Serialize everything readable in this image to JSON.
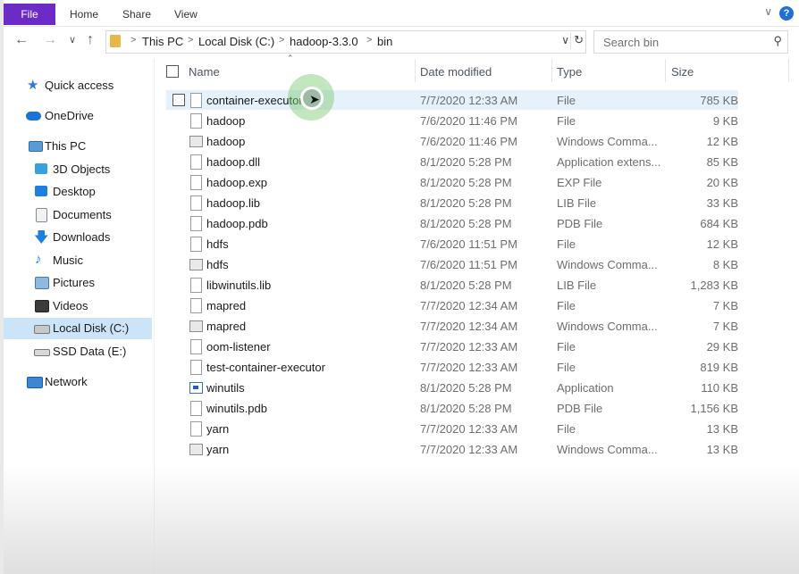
{
  "ribbon": {
    "tabs": [
      "File",
      "Home",
      "Share",
      "View"
    ],
    "help_icon": "help-icon",
    "accent": "#6c2bc6"
  },
  "address": {
    "crumbs": [
      "This PC",
      "Local Disk (C:)",
      "hadoop-3.3.0",
      "bin"
    ]
  },
  "search": {
    "placeholder": "Search bin"
  },
  "sidebar": {
    "items": [
      {
        "label": "Quick access",
        "icon": "star-icon"
      },
      {
        "label": "OneDrive",
        "icon": "cloud-icon"
      },
      {
        "label": "This PC",
        "icon": "computer-icon"
      },
      {
        "label": "3D Objects",
        "icon": "cube-icon"
      },
      {
        "label": "Desktop",
        "icon": "desktop-icon"
      },
      {
        "label": "Documents",
        "icon": "documents-icon"
      },
      {
        "label": "Downloads",
        "icon": "download-icon"
      },
      {
        "label": "Music",
        "icon": "music-icon"
      },
      {
        "label": "Pictures",
        "icon": "pictures-icon"
      },
      {
        "label": "Videos",
        "icon": "videos-icon"
      },
      {
        "label": "Local Disk (C:)",
        "icon": "drive-icon"
      },
      {
        "label": "SSD Data (E:)",
        "icon": "drive-icon"
      },
      {
        "label": "Network",
        "icon": "network-icon"
      }
    ],
    "selected_color": "#cce4f7"
  },
  "columns": [
    "Name",
    "Date modified",
    "Type",
    "Size"
  ],
  "files": [
    {
      "name": "container-executor",
      "date": "7/7/2020 12:33 AM",
      "type": "File",
      "size": "785 KB",
      "icon": "file-icon"
    },
    {
      "name": "hadoop",
      "date": "7/6/2020 11:46 PM",
      "type": "File",
      "size": "9 KB",
      "icon": "file-icon"
    },
    {
      "name": "hadoop",
      "date": "7/6/2020 11:46 PM",
      "type": "Windows Comma...",
      "size": "12 KB",
      "icon": "cmd-file-icon"
    },
    {
      "name": "hadoop.dll",
      "date": "8/1/2020 5:28 PM",
      "type": "Application extens...",
      "size": "85 KB",
      "icon": "dll-file-icon"
    },
    {
      "name": "hadoop.exp",
      "date": "8/1/2020 5:28 PM",
      "type": "EXP File",
      "size": "20 KB",
      "icon": "file-icon"
    },
    {
      "name": "hadoop.lib",
      "date": "8/1/2020 5:28 PM",
      "type": "LIB File",
      "size": "33 KB",
      "icon": "file-icon"
    },
    {
      "name": "hadoop.pdb",
      "date": "8/1/2020 5:28 PM",
      "type": "PDB File",
      "size": "684 KB",
      "icon": "file-icon"
    },
    {
      "name": "hdfs",
      "date": "7/6/2020 11:51 PM",
      "type": "File",
      "size": "12 KB",
      "icon": "file-icon"
    },
    {
      "name": "hdfs",
      "date": "7/6/2020 11:51 PM",
      "type": "Windows Comma...",
      "size": "8 KB",
      "icon": "cmd-file-icon"
    },
    {
      "name": "libwinutils.lib",
      "date": "8/1/2020 5:28 PM",
      "type": "LIB File",
      "size": "1,283 KB",
      "icon": "file-icon"
    },
    {
      "name": "mapred",
      "date": "7/7/2020 12:34 AM",
      "type": "File",
      "size": "7 KB",
      "icon": "file-icon"
    },
    {
      "name": "mapred",
      "date": "7/7/2020 12:34 AM",
      "type": "Windows Comma...",
      "size": "7 KB",
      "icon": "cmd-file-icon"
    },
    {
      "name": "oom-listener",
      "date": "7/7/2020 12:33 AM",
      "type": "File",
      "size": "29 KB",
      "icon": "file-icon"
    },
    {
      "name": "test-container-executor",
      "date": "7/7/2020 12:33 AM",
      "type": "File",
      "size": "819 KB",
      "icon": "file-icon"
    },
    {
      "name": "winutils",
      "date": "8/1/2020 5:28 PM",
      "type": "Application",
      "size": "110 KB",
      "icon": "app-icon"
    },
    {
      "name": "winutils.pdb",
      "date": "8/1/2020 5:28 PM",
      "type": "PDB File",
      "size": "1,156 KB",
      "icon": "file-icon"
    },
    {
      "name": "yarn",
      "date": "7/7/2020 12:33 AM",
      "type": "File",
      "size": "13 KB",
      "icon": "file-icon"
    },
    {
      "name": "yarn",
      "date": "7/7/2020 12:33 AM",
      "type": "Windows Comma...",
      "size": "13 KB",
      "icon": "cmd-file-icon"
    }
  ],
  "hover_row_color": "#e5f1fb"
}
